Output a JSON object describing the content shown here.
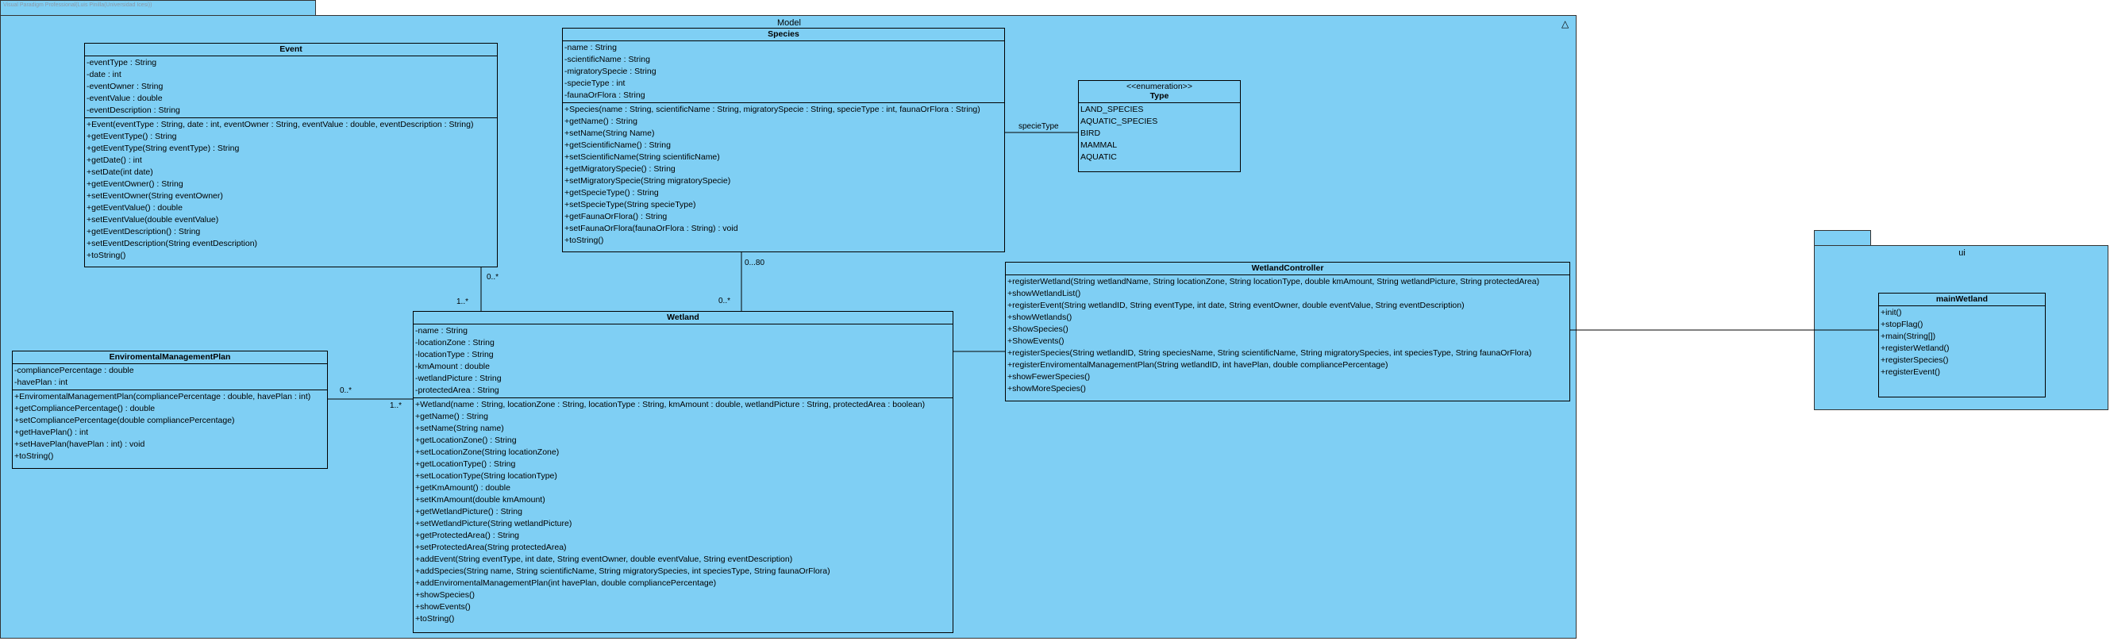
{
  "watermark": "Visual Paradigm Professional(Luis Pinilla(Universidad Icesi))",
  "packages": {
    "model": "Model",
    "ui": "ui"
  },
  "classes": {
    "event": {
      "name": "Event",
      "attributes": [
        "-eventType : String",
        "-date : int",
        "-eventOwner : String",
        "-eventValue : double",
        "-eventDescription : String"
      ],
      "operations": [
        "+Event(eventType : String, date : int, eventOwner : String, eventValue : double, eventDescription : String)",
        "+getEventType() : String",
        "+getEventType(String eventType) : String",
        "+getDate() : int",
        "+setDate(int date)",
        "+getEventOwner() : String",
        "+setEventOwner(String eventOwner)",
        "+getEventValue() : double",
        "+setEventValue(double eventValue)",
        "+getEventDescription() : String",
        "+setEventDescription(String eventDescription)",
        "+toString()"
      ]
    },
    "species": {
      "name": "Species",
      "attributes": [
        "-name : String",
        "-scientificName : String",
        "-migratorySpecie : String",
        "-specieType : int",
        "-faunaOrFlora : String"
      ],
      "operations": [
        "+Species(name : String, scientificName : String, migratorySpecie : String, specieType : int, faunaOrFlora : String)",
        "+getName() : String",
        "+setName(String Name)",
        "+getScientificName() : String",
        "+setScientificName(String scientificName)",
        "+getMigratorySpecie() : String",
        "+setMigratorySpecie(String migratorySpecie)",
        "+getSpecieType() : String",
        "+setSpecieType(String specieType)",
        "+getFaunaOrFlora() : String",
        "+setFaunaOrFlora(faunaOrFlora : String) : void",
        "+toString()"
      ]
    },
    "type": {
      "stereotype": "<<enumeration>>",
      "name": "Type",
      "literals": [
        "LAND_SPECIES",
        "AQUATIC_SPECIES",
        "BIRD",
        "MAMMAL",
        "AQUATIC"
      ]
    },
    "plan": {
      "name": "EnviromentalManagementPlan",
      "attributes": [
        "-compliancePercentage : double",
        "-havePlan : int"
      ],
      "operations": [
        "+EnviromentalManagementPlan(compliancePercentage : double, havePlan : int)",
        "+getCompliancePercentage() : double",
        "+setCompliancePercentage(double compliancePercentage)",
        "+getHavePlan() : int",
        "+setHavePlan(havePlan : int) : void",
        "+toString()"
      ]
    },
    "wetland": {
      "name": "Wetland",
      "attributes": [
        "-name : String",
        "-locationZone : String",
        "-locationType : String",
        "-kmAmount : double",
        "-wetlandPicture : String",
        "-protectedArea : String"
      ],
      "operations": [
        "+Wetland(name : String, locationZone : String, locationType : String, kmAmount : double, wetlandPicture : String, protectedArea : boolean)",
        "+getName() : String",
        "+setName(String name)",
        "+getLocationZone() : String",
        "+setLocationZone(String locationZone)",
        "+getLocationType() : String",
        "+setLocationType(String locationType)",
        "+getKmAmount() : double",
        "+setKmAmount(double kmAmount)",
        "+getWetlandPicture() : String",
        "+setWetlandPicture(String wetlandPicture)",
        "+getProtectedArea() : String",
        "+setProtectedArea(String protectedArea)",
        "+addEvent(String eventType, int date, String eventOwner, double eventValue, String eventDescription)",
        "+addSpecies(String name, String scientificName, String migratorySpecies, int speciesType, String faunaOrFlora)",
        "+addEnviromentalManagementPlan(int havePlan, double compliancePercentage)",
        "+showSpecies()",
        "+showEvents()",
        "+toString()"
      ]
    },
    "controller": {
      "name": "WetlandController",
      "operations": [
        "+registerWetland(String wetlandName, String locationZone, String locationType, double kmAmount, String wetlandPicture, String protectedArea)",
        "+showWetlandList()",
        "+registerEvent(String wetlandID, String eventType, int date, String eventOwner, double eventValue, String eventDescription)",
        "+showWetlands()",
        "+ShowSpecies()",
        "+ShowEvents()",
        "+registerSpecies(String wetlandID, String speciesName, String scientificName, String migratorySpecies, int speciesType, String faunaOrFlora)",
        "+registerEnviromentalManagementPlan(String wetlandID, int havePlan, double compliancePercentage)",
        "+showFewerSpecies()",
        "+showMoreSpecies()"
      ]
    },
    "main": {
      "name": "mainWetland",
      "operations": [
        "+init()",
        "+stopFlag()",
        "+main(String[])",
        "+registerWetland()",
        "+registerSpecies()",
        "+registerEvent()"
      ]
    }
  },
  "associations": {
    "event_wetland": {
      "event_end": "0..*",
      "wetland_end": "1..*"
    },
    "species_wetland": {
      "species_end": "0...80",
      "wetland_end": "0..*"
    },
    "plan_wetland": {
      "plan_end": "0..*",
      "wetland_end": "1..*"
    },
    "species_type": {
      "role": "specieType"
    }
  }
}
